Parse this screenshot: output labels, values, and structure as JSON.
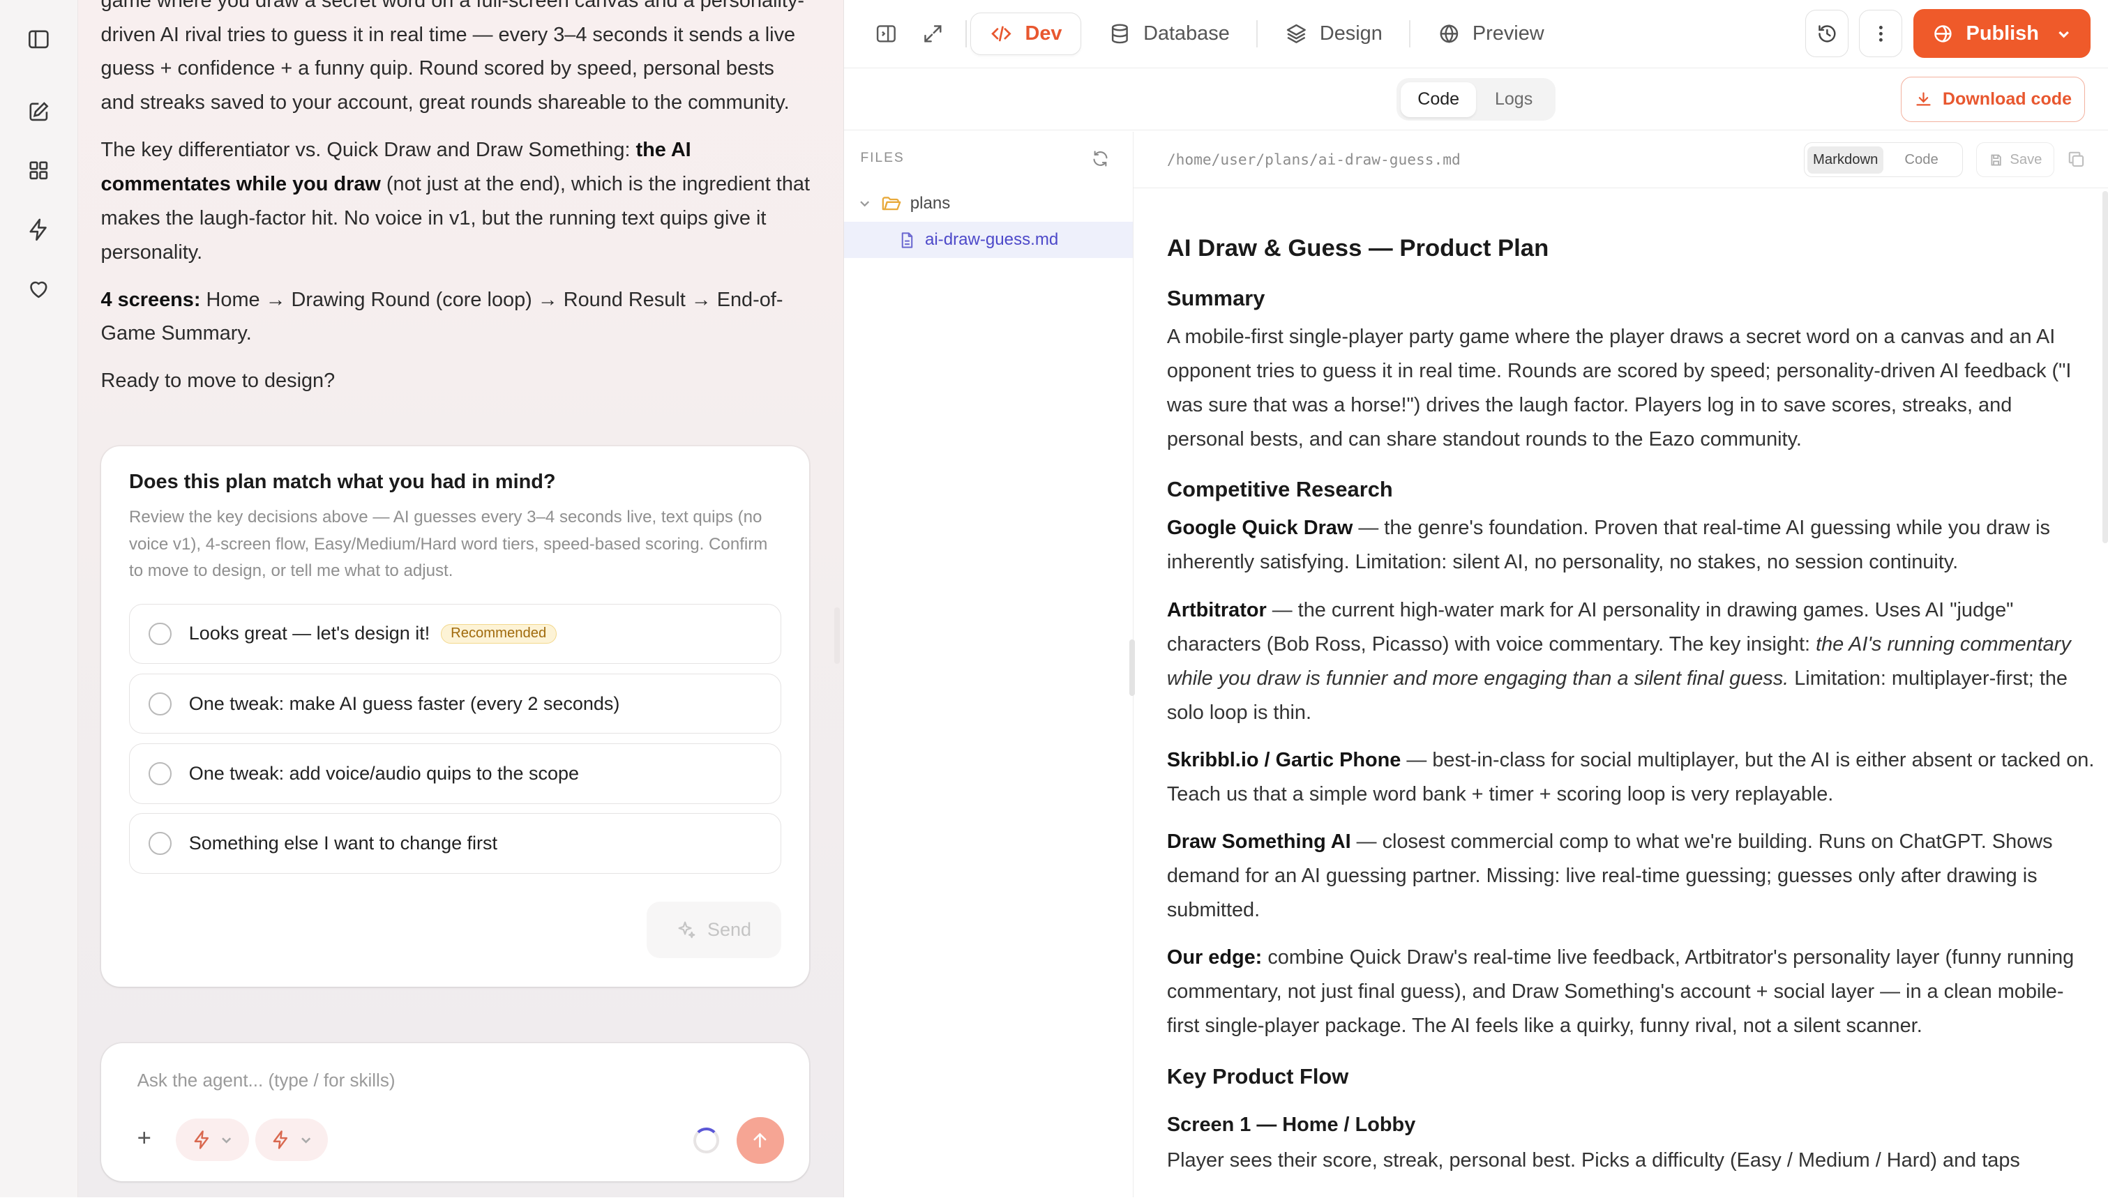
{
  "chat": {
    "paragraphs": [
      [
        {
          "t": "game where you draw a secret word on a full-screen canvas and a personality-driven AI rival tries to guess it in real time — every 3–4 seconds it sends a live guess + confidence + a funny quip. Round scored by speed, personal bests and streaks saved to your account, great rounds shareable to the community.",
          "b": false
        }
      ],
      [
        {
          "t": "The key differentiator vs. Quick Draw and Draw Something: ",
          "b": false
        },
        {
          "t": "the AI commentates while you draw",
          "b": true
        },
        {
          "t": " (not just at the end), which is the ingredient that makes the laugh-factor hit. No voice in v1, but the running text quips give it personality.",
          "b": false
        }
      ],
      [
        {
          "t": "4 screens:",
          "b": true
        },
        {
          "t": " Home → Drawing Round (core loop) → Round Result → End-of-Game Summary.",
          "b": false
        }
      ],
      [
        {
          "t": "Ready to move to design?",
          "b": false
        }
      ]
    ],
    "question": {
      "title": "Does this plan match what you had in mind?",
      "description": "Review the key decisions above — AI guesses every 3–4 seconds live, text quips (no voice v1), 4-screen flow, Easy/Medium/Hard word tiers, speed-based scoring. Confirm to move to design, or tell me what to adjust.",
      "options": [
        {
          "label": "Looks great — let's design it!",
          "badge": "Recommended"
        },
        {
          "label": "One tweak: make AI guess faster (every 2 seconds)",
          "badge": ""
        },
        {
          "label": "One tweak: add voice/audio quips to the scope",
          "badge": ""
        },
        {
          "label": "Something else I want to change first",
          "badge": ""
        }
      ],
      "send_label": "Send"
    },
    "composer": {
      "placeholder": "Ask the agent... (type / for skills)",
      "plus": "+"
    }
  },
  "topbar": {
    "tabs": [
      {
        "label": "Dev",
        "icon": "code-icon",
        "active": true
      },
      {
        "label": "Database",
        "icon": "database-icon",
        "active": false
      },
      {
        "label": "Design",
        "icon": "layers-icon",
        "active": false
      },
      {
        "label": "Preview",
        "icon": "globe-icon",
        "active": false
      }
    ],
    "publish_label": "Publish"
  },
  "subbar": {
    "view_tabs": [
      "Code",
      "Logs"
    ],
    "active_view": "Code",
    "download_label": "Download code"
  },
  "files": {
    "header": "FILES",
    "folder": "plans",
    "file": "ai-draw-guess.md"
  },
  "editor": {
    "path": "/home/user/plans/ai-draw-guess.md",
    "modes": [
      "Markdown",
      "Code"
    ],
    "active_mode": "Markdown",
    "save_label": "Save"
  },
  "document": [
    {
      "type": "h1",
      "text": "AI Draw & Guess — Product Plan"
    },
    {
      "type": "h2",
      "text": "Summary"
    },
    {
      "type": "p",
      "runs": [
        {
          "t": "A mobile-first single-player party game where the player draws a secret word on a canvas and an AI opponent tries to guess it in real time. Rounds are scored by speed; personality-driven AI feedback (\"I was sure that was a horse!\") drives the laugh factor. Players log in to save scores, streaks, and personal bests, and can share standout rounds to the Eazo community."
        }
      ]
    },
    {
      "type": "h2",
      "text": "Competitive Research"
    },
    {
      "type": "p",
      "runs": [
        {
          "t": "Google Quick Draw",
          "s": "b"
        },
        {
          "t": " — the genre's foundation. Proven that real-time AI guessing while you draw is inherently satisfying. Limitation: silent AI, no personality, no stakes, no session continuity."
        }
      ]
    },
    {
      "type": "p",
      "runs": [
        {
          "t": "Artbitrator",
          "s": "b"
        },
        {
          "t": " — the current high-water mark for AI personality in drawing games. Uses AI \"judge\" characters (Bob Ross, Picasso) with voice commentary. The key insight: "
        },
        {
          "t": "the AI's running commentary while you draw is funnier and more engaging than a silent final guess.",
          "s": "i"
        },
        {
          "t": " Limitation: multiplayer-first; the solo loop is thin."
        }
      ]
    },
    {
      "type": "p",
      "runs": [
        {
          "t": "Skribbl.io / Gartic Phone",
          "s": "b"
        },
        {
          "t": " — best-in-class for social multiplayer, but the AI is either absent or tacked on. Teach us that a simple word bank + timer + scoring loop is very replayable."
        }
      ]
    },
    {
      "type": "p",
      "runs": [
        {
          "t": "Draw Something AI",
          "s": "b"
        },
        {
          "t": " — closest commercial comp to what we're building. Runs on ChatGPT. Shows demand for an AI guessing partner. Missing: live real-time guessing; guesses only after drawing is submitted."
        }
      ]
    },
    {
      "type": "p",
      "runs": [
        {
          "t": "Our edge:",
          "s": "b"
        },
        {
          "t": " combine Quick Draw's real-time live feedback, Artbitrator's personality layer (funny running commentary, not just final guess), and Draw Something's account + social layer — in a clean mobile-first single-player package. The AI feels like a quirky, funny rival, not a silent scanner."
        }
      ]
    },
    {
      "type": "h2",
      "text": "Key Product Flow"
    },
    {
      "type": "h3",
      "text": "Screen 1 — Home / Lobby"
    },
    {
      "type": "p",
      "runs": [
        {
          "t": "Player sees their score, streak, personal best. Picks a difficulty (Easy / Medium / Hard) and taps"
        }
      ]
    }
  ]
}
